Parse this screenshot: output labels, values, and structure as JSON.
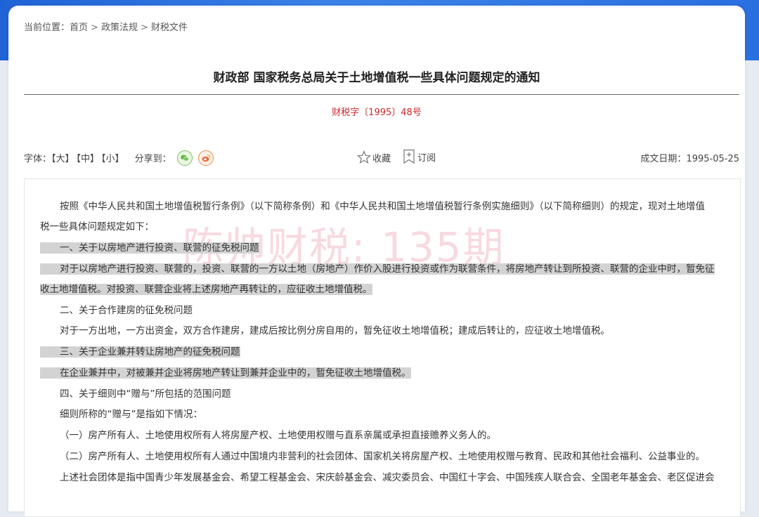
{
  "breadcrumb": {
    "prefix": "当前位置：",
    "items": [
      "首页",
      "政策法规",
      "财税文件"
    ],
    "separator": ">"
  },
  "doc": {
    "title": "财政部 国家税务总局关于土地增值税一些具体问题规定的通知",
    "number": "财税字〔1995〕48号"
  },
  "toolbar": {
    "font_label": "字体：",
    "font_large": "【大】",
    "font_medium": "【中】",
    "font_small": "【小】",
    "share_label": "分享到：",
    "share_icons": [
      "wechat-icon",
      "weibo-icon"
    ],
    "favorite": "收藏",
    "subscribe": "订阅",
    "date_label": "成文日期：",
    "date": "1995-05-25"
  },
  "watermark": "陈帅财税: 135期",
  "colors": {
    "header_blue": "#2a6fe0",
    "doc_number_red": "#c8272b",
    "highlight_gray": "#d3d3d3",
    "watermark_pink": "#e896a5"
  },
  "content": [
    {
      "text": "按照《中华人民共和国土地增值税暂行条例》（以下简称条例）和《中华人民共和国土地增值税暂行条例实施细则》（以下简称细则）的规定，现对土地增值",
      "highlight": false
    },
    {
      "text": "税一些具体问题规定如下：",
      "highlight": false
    },
    {
      "text": "一、关于以房地产进行投资、联营的征免税问题",
      "highlight": true
    },
    {
      "text": "对于以房地产进行投资、联营的，投资、联营的一方以土地（房地产）作价入股进行投资或作为联营条件，将房地产转让到所投资、联营的企业中时，暂免征",
      "highlight": true
    },
    {
      "text": "收土地增值税。对投资、联营企业将上述房地产再转让的，应征收土地增值税。",
      "highlight": true
    },
    {
      "text": "二、关于合作建房的征免税问题",
      "highlight": false
    },
    {
      "text": "对于一方出地，一方出资金，双方合作建房，建成后按比例分房自用的，暂免征收土地增值税；建成后转让的，应征收土地增值税。",
      "highlight": false
    },
    {
      "text": "三、关于企业兼并转让房地产的征免税问题",
      "highlight": true
    },
    {
      "text": "在企业兼并中，对被兼并企业将房地产转让到兼并企业中的，暂免征收土地增值税。",
      "highlight": true
    },
    {
      "text": "四、关于细则中“赠与”所包括的范围问题",
      "highlight": false
    },
    {
      "text": "细则所称的“赠与”是指如下情况：",
      "highlight": false
    },
    {
      "text": "（一）房产所有人、土地使用权所有人将房屋产权、土地使用权赠与直系亲属或承担直接赡养义务人的。",
      "highlight": false
    },
    {
      "text": "（二）房产所有人、土地使用权所有人通过中国境内非营利的社会团体、国家机关将房屋产权、土地使用权赠与教育、民政和其他社会福利、公益事业的。",
      "highlight": false
    },
    {
      "text": "上述社会团体是指中国青少年发展基金会、希望工程基金会、宋庆龄基金会、减灾委员会、中国红十字会、中国残疾人联合会、全国老年基金会、老区促进会",
      "highlight": false
    }
  ]
}
